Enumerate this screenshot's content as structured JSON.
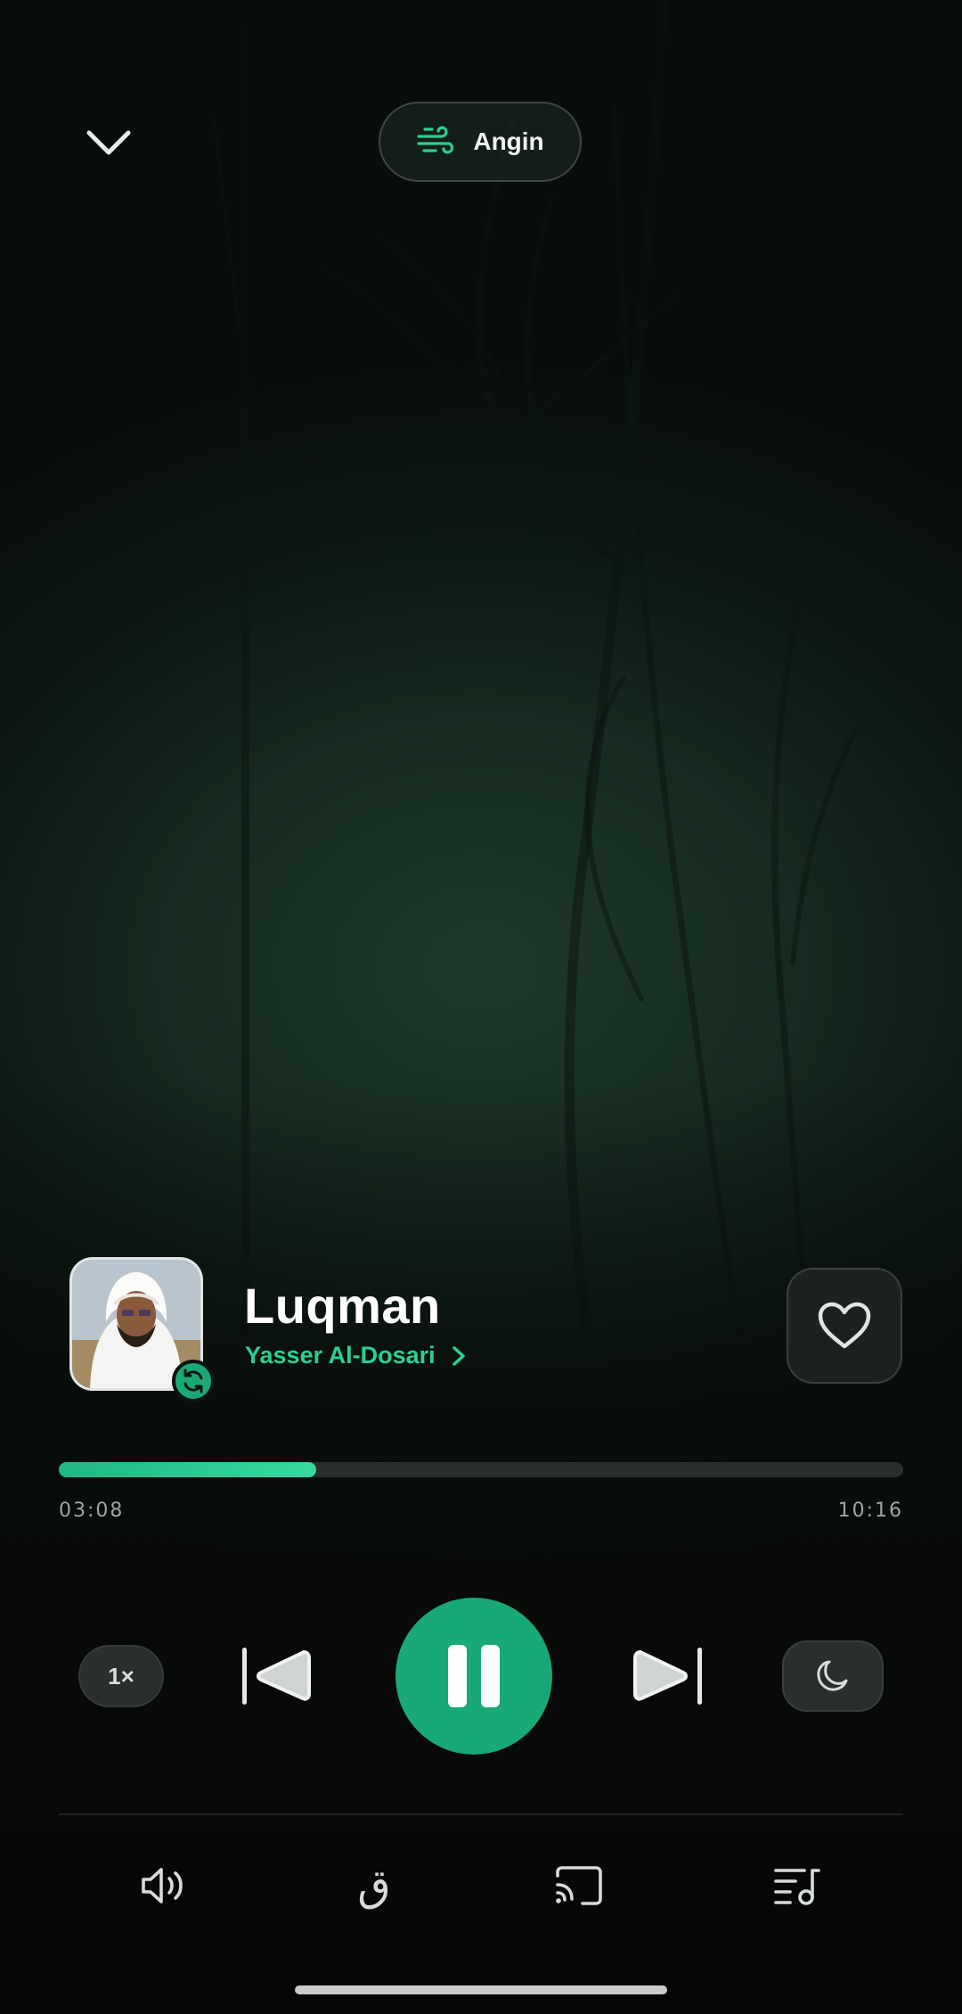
{
  "top_bar": {
    "collapse_icon": "chevron-down-icon",
    "ambient_sound": {
      "icon": "wind-icon",
      "label": "Angin"
    }
  },
  "track": {
    "title": "Luqman",
    "reciter": "Yasser Al-Dosari",
    "reciter_chevron_icon": "chevron-right-icon",
    "cover_badge_icon": "sync-icon",
    "favorite_icon": "heart-icon"
  },
  "progress": {
    "elapsed": "03:08",
    "total": "10:16",
    "fraction": 0.305
  },
  "controls": {
    "speed_label": "1×",
    "previous_icon": "skip-previous-icon",
    "play_state_icon": "pause-icon",
    "next_icon": "skip-next-icon",
    "sleep_timer_icon": "moon-icon"
  },
  "toolbar": {
    "volume_icon": "volume-icon",
    "quran_text_glyph": "ق",
    "cast_icon": "cast-icon",
    "queue_icon": "queue-music-icon"
  },
  "colors": {
    "accent": "#18a87a",
    "accent_text": "#2ccf93",
    "background": "#0a0f0d"
  }
}
